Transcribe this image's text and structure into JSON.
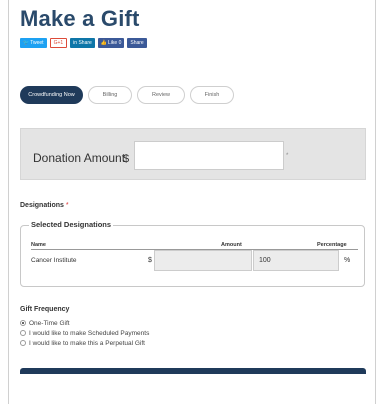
{
  "page": {
    "title": "Make a Gift"
  },
  "share": {
    "tweet": "Tweet",
    "gplus": "G+1",
    "linkedin": "in Share",
    "fb_like": "Like 0",
    "fb_share": "Share"
  },
  "steps": [
    {
      "label": "Crowdfunding Now",
      "active": true
    },
    {
      "label": "Billing",
      "active": false
    },
    {
      "label": "Review",
      "active": false
    },
    {
      "label": "Finish",
      "active": false
    }
  ],
  "donation": {
    "label": "Donation Amount",
    "currency": "$",
    "value": "",
    "required_marker": "*"
  },
  "designations": {
    "title": "Designations",
    "required_marker": "*",
    "legend": "Selected Designations",
    "columns": {
      "name": "Name",
      "amount": "Amount",
      "percentage": "Percentage"
    },
    "rows": [
      {
        "name": "Cancer Institute",
        "currency": "$",
        "amount": "",
        "percentage": "100",
        "pct_sign": "%"
      }
    ]
  },
  "frequency": {
    "title": "Gift Frequency",
    "options": [
      {
        "label": "One-Time Gift",
        "checked": true
      },
      {
        "label": "I would like to make Scheduled Payments",
        "checked": false
      },
      {
        "label": "I would like to make this a Perpetual Gift",
        "checked": false
      }
    ]
  },
  "colors": {
    "accent": "#1f3a5a",
    "title": "#2a4a6b",
    "panel": "#e4e4e4"
  }
}
